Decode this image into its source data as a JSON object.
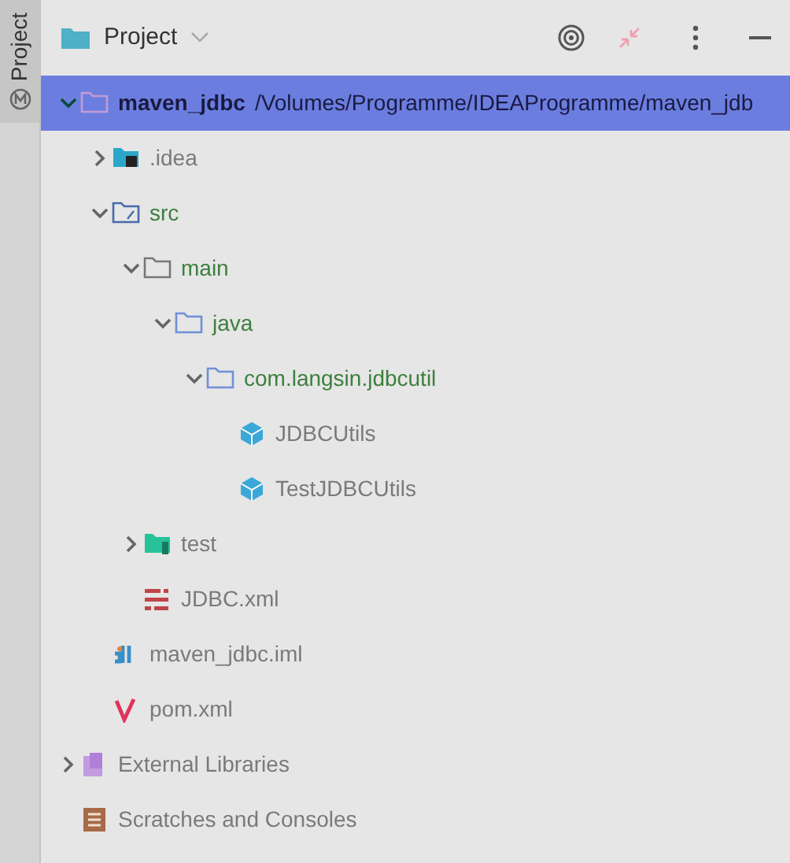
{
  "side_tab": {
    "label": "Project",
    "selected": true
  },
  "header": {
    "title": "Project"
  },
  "tree": [
    {
      "kind": "module",
      "label": "maven_jdbc",
      "path": "/Volumes/Programme/IDEAProgramme/maven_jdb",
      "selected": true,
      "expanded": true,
      "children": [
        {
          "kind": "idea",
          "label": ".idea",
          "color": "#7a7a7a",
          "selected": false,
          "expanded": false
        },
        {
          "kind": "source-root",
          "label": "src",
          "color": "#3d7f3d",
          "selected": false,
          "expanded": true,
          "children": [
            {
              "kind": "folder",
              "label": "main",
              "color": "#3d7f3d",
              "selected": false,
              "expanded": true,
              "children": [
                {
                  "kind": "java-folder",
                  "label": "java",
                  "color": "#3d7f3d",
                  "selected": false,
                  "expanded": true,
                  "children": [
                    {
                      "kind": "package",
                      "label": "com.langsin.jdbcutil",
                      "color": "#3d7f3d",
                      "selected": false,
                      "expanded": true,
                      "children": [
                        {
                          "kind": "class",
                          "label": "JDBCUtils",
                          "color": "#7a7a7a",
                          "selected": false
                        },
                        {
                          "kind": "class",
                          "label": "TestJDBCUtils",
                          "color": "#7a7a7a",
                          "selected": false
                        }
                      ]
                    }
                  ]
                }
              ]
            },
            {
              "kind": "test-folder",
              "label": "test",
              "color": "#7a7a7a",
              "selected": false,
              "expanded": false
            },
            {
              "kind": "xml",
              "label": "JDBC.xml",
              "color": "#7a7a7a",
              "selected": false
            }
          ]
        },
        {
          "kind": "iml",
          "label": "maven_jdbc.iml",
          "color": "#7a7a7a",
          "selected": false
        },
        {
          "kind": "maven",
          "label": "pom.xml",
          "color": "#7a7a7a",
          "selected": false
        }
      ]
    },
    {
      "kind": "libraries",
      "label": "External Libraries",
      "color": "#7a7a7a",
      "selected": false,
      "expanded": false
    },
    {
      "kind": "scratches",
      "label": "Scratches and Consoles",
      "color": "#7a7a7a",
      "selected": false
    }
  ]
}
